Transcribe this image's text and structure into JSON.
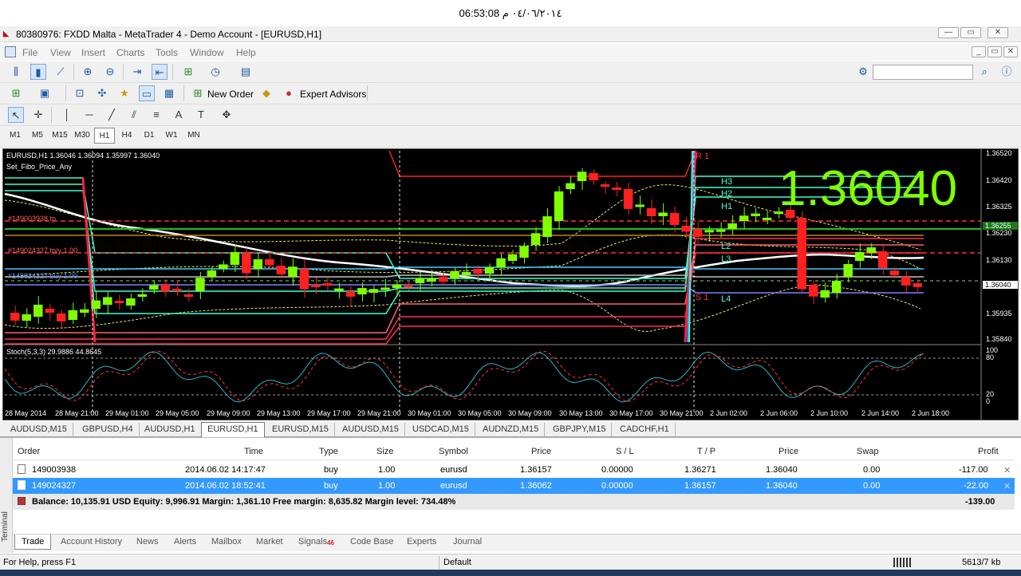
{
  "clock": "06:53:08 ٠٤/٠٦/٢٠١٤ م",
  "window": {
    "title": "80380976: FXDD Malta - MetaTrader 4 - Demo Account - [EURUSD,H1]"
  },
  "menu": [
    "File",
    "View",
    "Insert",
    "Charts",
    "Tools",
    "Window",
    "Help"
  ],
  "toolbar": {
    "new_order": "New Order",
    "expert_advisors": "Expert Advisors",
    "search_placeholder": ""
  },
  "timeframes": [
    "M1",
    "M5",
    "M15",
    "M30",
    "H1",
    "H4",
    "D1",
    "W1",
    "MN"
  ],
  "active_timeframe": "H1",
  "chart": {
    "header": "EURUSD,H1  1.36046 1.36094 1.35997 1.36040",
    "indicator_name": "Set_Fibo_Price_Any",
    "big_price": "1.36040",
    "order_labels": [
      "#149003938 tp",
      "#149024327 tp/y 1.00",
      "#149024327 buy 1.00"
    ],
    "level_labels": [
      "R 1",
      "H3",
      "H2",
      "H1",
      "L2",
      "L3",
      "S 1",
      "L4"
    ],
    "price_axis": [
      "1.36520",
      "1.36420",
      "1.36325",
      "1.36230",
      "1.36130",
      "1.36040",
      "1.35935",
      "1.35840"
    ],
    "current_price_tag": "1.36040",
    "tp_tag": "1.36255",
    "stoch_header": "Stoch(5,3,3) 29.9886 44.8645",
    "stoch_axis": [
      "100",
      "80",
      "20",
      "0"
    ],
    "time_axis": [
      "28 May 2014",
      "28 May 21:00",
      "29 May 01:00",
      "29 May 05:00",
      "29 May 09:00",
      "29 May 13:00",
      "29 May 17:00",
      "29 May 21:00",
      "30 May 01:00",
      "30 May 05:00",
      "30 May 09:00",
      "30 May 13:00",
      "30 May 17:00",
      "30 May 21:00",
      "2 Jun 02:00",
      "2 Jun 06:00",
      "2 Jun 10:00",
      "2 Jun 14:00",
      "2 Jun 18:00"
    ],
    "colors": {
      "bull": "#7fff00",
      "bear": "#ff2020",
      "ma": "#ffffff",
      "stoch_main": "#2bb5c8",
      "stoch_signal": "#ff3030"
    }
  },
  "chart_data": {
    "type": "candlestick",
    "symbol": "EURUSD",
    "timeframe": "H1",
    "ylim": [
      1.3584,
      1.3652
    ],
    "last": 1.3604
  },
  "symbol_tabs": [
    "AUDUSD,M15",
    "GBPUSD,H4",
    "AUDUSD,H1",
    "EURUSD,H1",
    "EURUSD,M15",
    "AUDUSD,M15",
    "USDCAD,M15",
    "AUDNZD,M15",
    "GBPJPY,M15",
    "CADCHF,H1"
  ],
  "active_symbol_tab": "EURUSD,H1",
  "terminal": {
    "label": "Terminal",
    "columns": [
      "Order",
      "Time",
      "Type",
      "Size",
      "Symbol",
      "Price",
      "S / L",
      "T / P",
      "Price",
      "Swap",
      "Profit"
    ],
    "rows": [
      {
        "order": "149003938",
        "time": "2014.06.02 14:17:47",
        "type": "buy",
        "size": "1.00",
        "symbol": "eurusd",
        "price": "1.36157",
        "sl": "0.00000",
        "tp": "1.36271",
        "cur": "1.36040",
        "swap": "0.00",
        "profit": "-117.00"
      },
      {
        "order": "149024327",
        "time": "2014.06.02 18:52:41",
        "type": "buy",
        "size": "1.00",
        "symbol": "eurusd",
        "price": "1.36062",
        "sl": "0.00000",
        "tp": "1.36157",
        "cur": "1.36040",
        "swap": "0.00",
        "profit": "-22.00"
      }
    ],
    "balance": "Balance: 10,135.91 USD  Equity: 9,996.91  Margin: 1,361.10  Free margin: 8,635.82  Margin level: 734.48%",
    "total": "-139.00",
    "tabs": [
      "Trade",
      "Account History",
      "News",
      "Alerts",
      "Mailbox",
      "Market",
      "Signals",
      "Code Base",
      "Experts",
      "Journal"
    ],
    "signals_badge": "46"
  },
  "status": {
    "help": "For Help, press F1",
    "profile": "Default",
    "traffic": "5613/7 kb"
  }
}
